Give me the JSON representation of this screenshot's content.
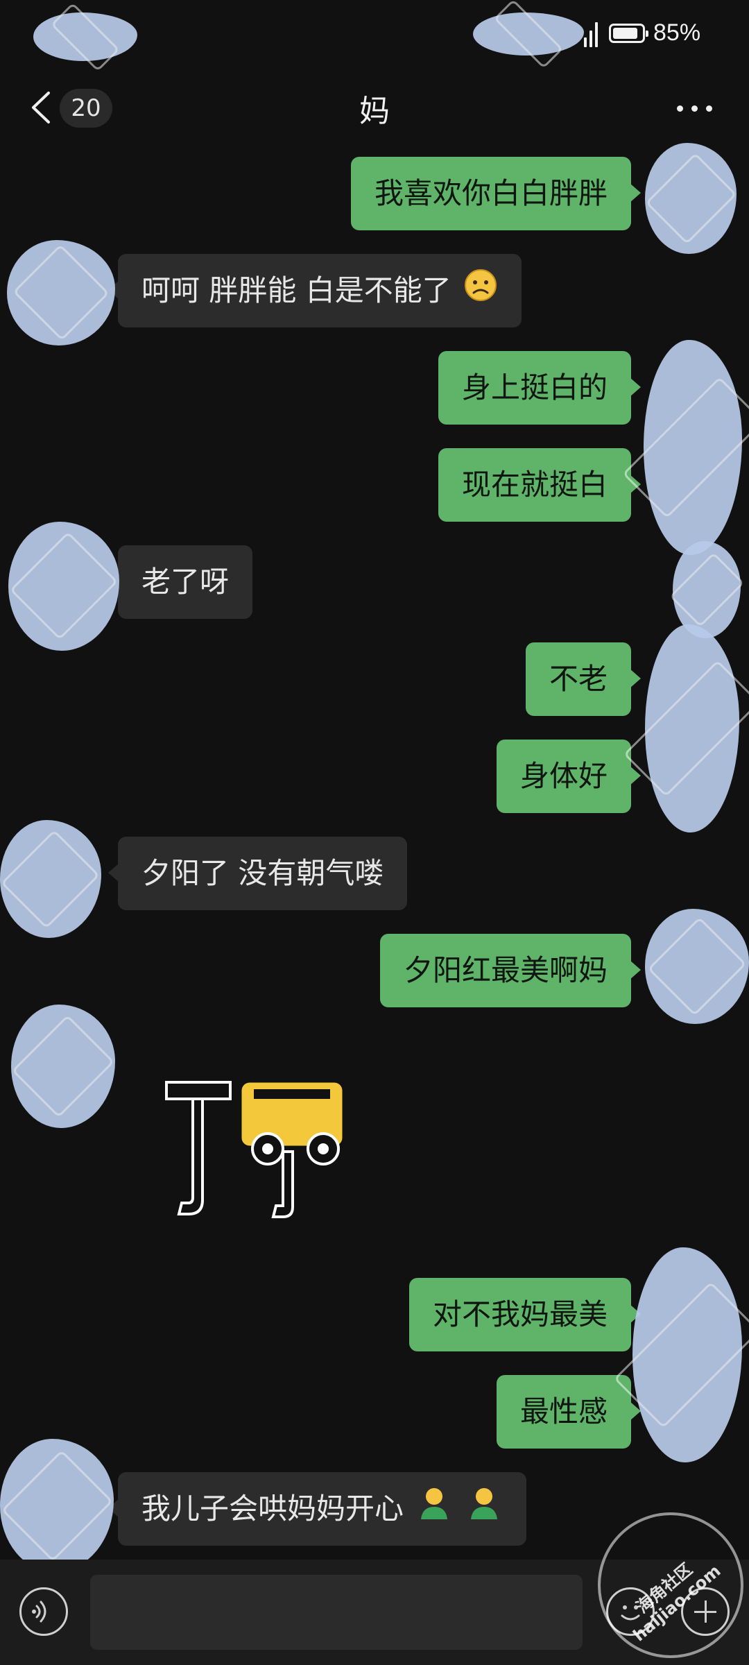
{
  "status_bar": {
    "battery_percent": "85%",
    "battery_level": 0.85
  },
  "header": {
    "back_icon": "chevron-left-icon",
    "unread_count": "20",
    "title": "妈",
    "more_icon": "more-dots-icon"
  },
  "messages": [
    {
      "side": "out",
      "text": "我喜欢你白白胖胖"
    },
    {
      "side": "in",
      "text": "呵呵 胖胖能 白是不能了",
      "emoji": "sad-face-emoji"
    },
    {
      "side": "out",
      "text": "身上挺白的"
    },
    {
      "side": "out",
      "text": "现在就挺白"
    },
    {
      "side": "in",
      "text": "老了呀"
    },
    {
      "side": "out",
      "text": "不老"
    },
    {
      "side": "out",
      "text": "身体好"
    },
    {
      "side": "in",
      "text": "夕阳了 没有朝气喽"
    },
    {
      "side": "out",
      "text": "夕阳红最美啊妈"
    },
    {
      "side": "in",
      "type": "sticker",
      "sticker_icon": "sticker-image"
    },
    {
      "side": "out",
      "text": "对不我妈最美"
    },
    {
      "side": "out",
      "text": "最性感"
    },
    {
      "side": "in",
      "text": "我儿子会哄妈妈开心",
      "emoji": "person-emoji"
    }
  ],
  "input_bar": {
    "voice_icon": "voice-icon",
    "emoji_icon": "emoji-icon",
    "plus_icon": "plus-icon"
  },
  "watermark": {
    "line1": "海角社区",
    "line2": "haijiao.com"
  },
  "colors": {
    "background": "#111111",
    "outgoing_bubble": "#5fb46a",
    "incoming_bubble": "#2c2c2c",
    "redaction_blob": "#b9cbea"
  }
}
